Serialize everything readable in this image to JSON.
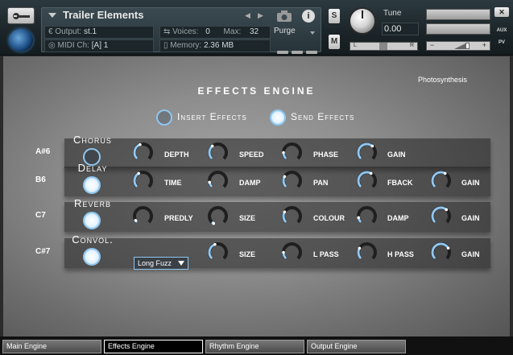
{
  "header": {
    "instrument_title": "Trailer Elements",
    "output_label": "Output:",
    "output_value": "st.1",
    "voices_label": "Voices:",
    "voices_value": "0",
    "max_label": "Max:",
    "max_value": "32",
    "purge_label": "Purge",
    "midi_label": "MIDI Ch:",
    "midi_value": "[A] 1",
    "memory_label": "Memory:",
    "memory_value": "2.36 MB",
    "solo_label": "S",
    "mute_label": "M",
    "tune_label": "Tune",
    "tune_value": "0.00",
    "pan_left": "L",
    "pan_right": "R",
    "vol_minus": "−",
    "vol_plus": "+",
    "close_label": "✕",
    "aux_label": "AUX",
    "pv_label": "PV"
  },
  "panel": {
    "title": "EFFECTS ENGINE",
    "preset_name": "Photosynthesis",
    "insert_label": "Insert Effects",
    "send_label": "Send Effects",
    "insert_on": false,
    "send_on": true
  },
  "rows": [
    {
      "note": "A#6",
      "name": "Chorus",
      "on": false,
      "params": [
        {
          "label": "DEPTH"
        },
        {
          "label": "SPEED"
        },
        {
          "label": "PHASE"
        },
        {
          "label": "GAIN"
        }
      ]
    },
    {
      "note": "B6",
      "name": "Delay",
      "on": true,
      "params": [
        {
          "label": "TIME"
        },
        {
          "label": "DAMP"
        },
        {
          "label": "PAN"
        },
        {
          "label": "FBACK"
        },
        {
          "label": "GAIN"
        }
      ]
    },
    {
      "note": "C7",
      "name": "Reverb",
      "on": true,
      "params": [
        {
          "label": "PREDLY"
        },
        {
          "label": "SIZE"
        },
        {
          "label": "COLOUR"
        },
        {
          "label": "DAMP"
        },
        {
          "label": "GAIN"
        }
      ]
    },
    {
      "note": "C#7",
      "name": "Convol.",
      "on": true,
      "ir_select": "Long Fuzz",
      "params": [
        {
          "label": "SIZE"
        },
        {
          "label": "L PASS"
        },
        {
          "label": "H PASS"
        },
        {
          "label": "GAIN"
        }
      ]
    }
  ],
  "tabs": [
    {
      "label": "Main Engine",
      "active": false
    },
    {
      "label": "Effects Engine",
      "active": true
    },
    {
      "label": "Rhythm Engine",
      "active": false
    },
    {
      "label": "Output Engine",
      "active": false
    }
  ],
  "colors": {
    "accent": "#8fc6ef",
    "knob_track": "#1f1f1f"
  }
}
